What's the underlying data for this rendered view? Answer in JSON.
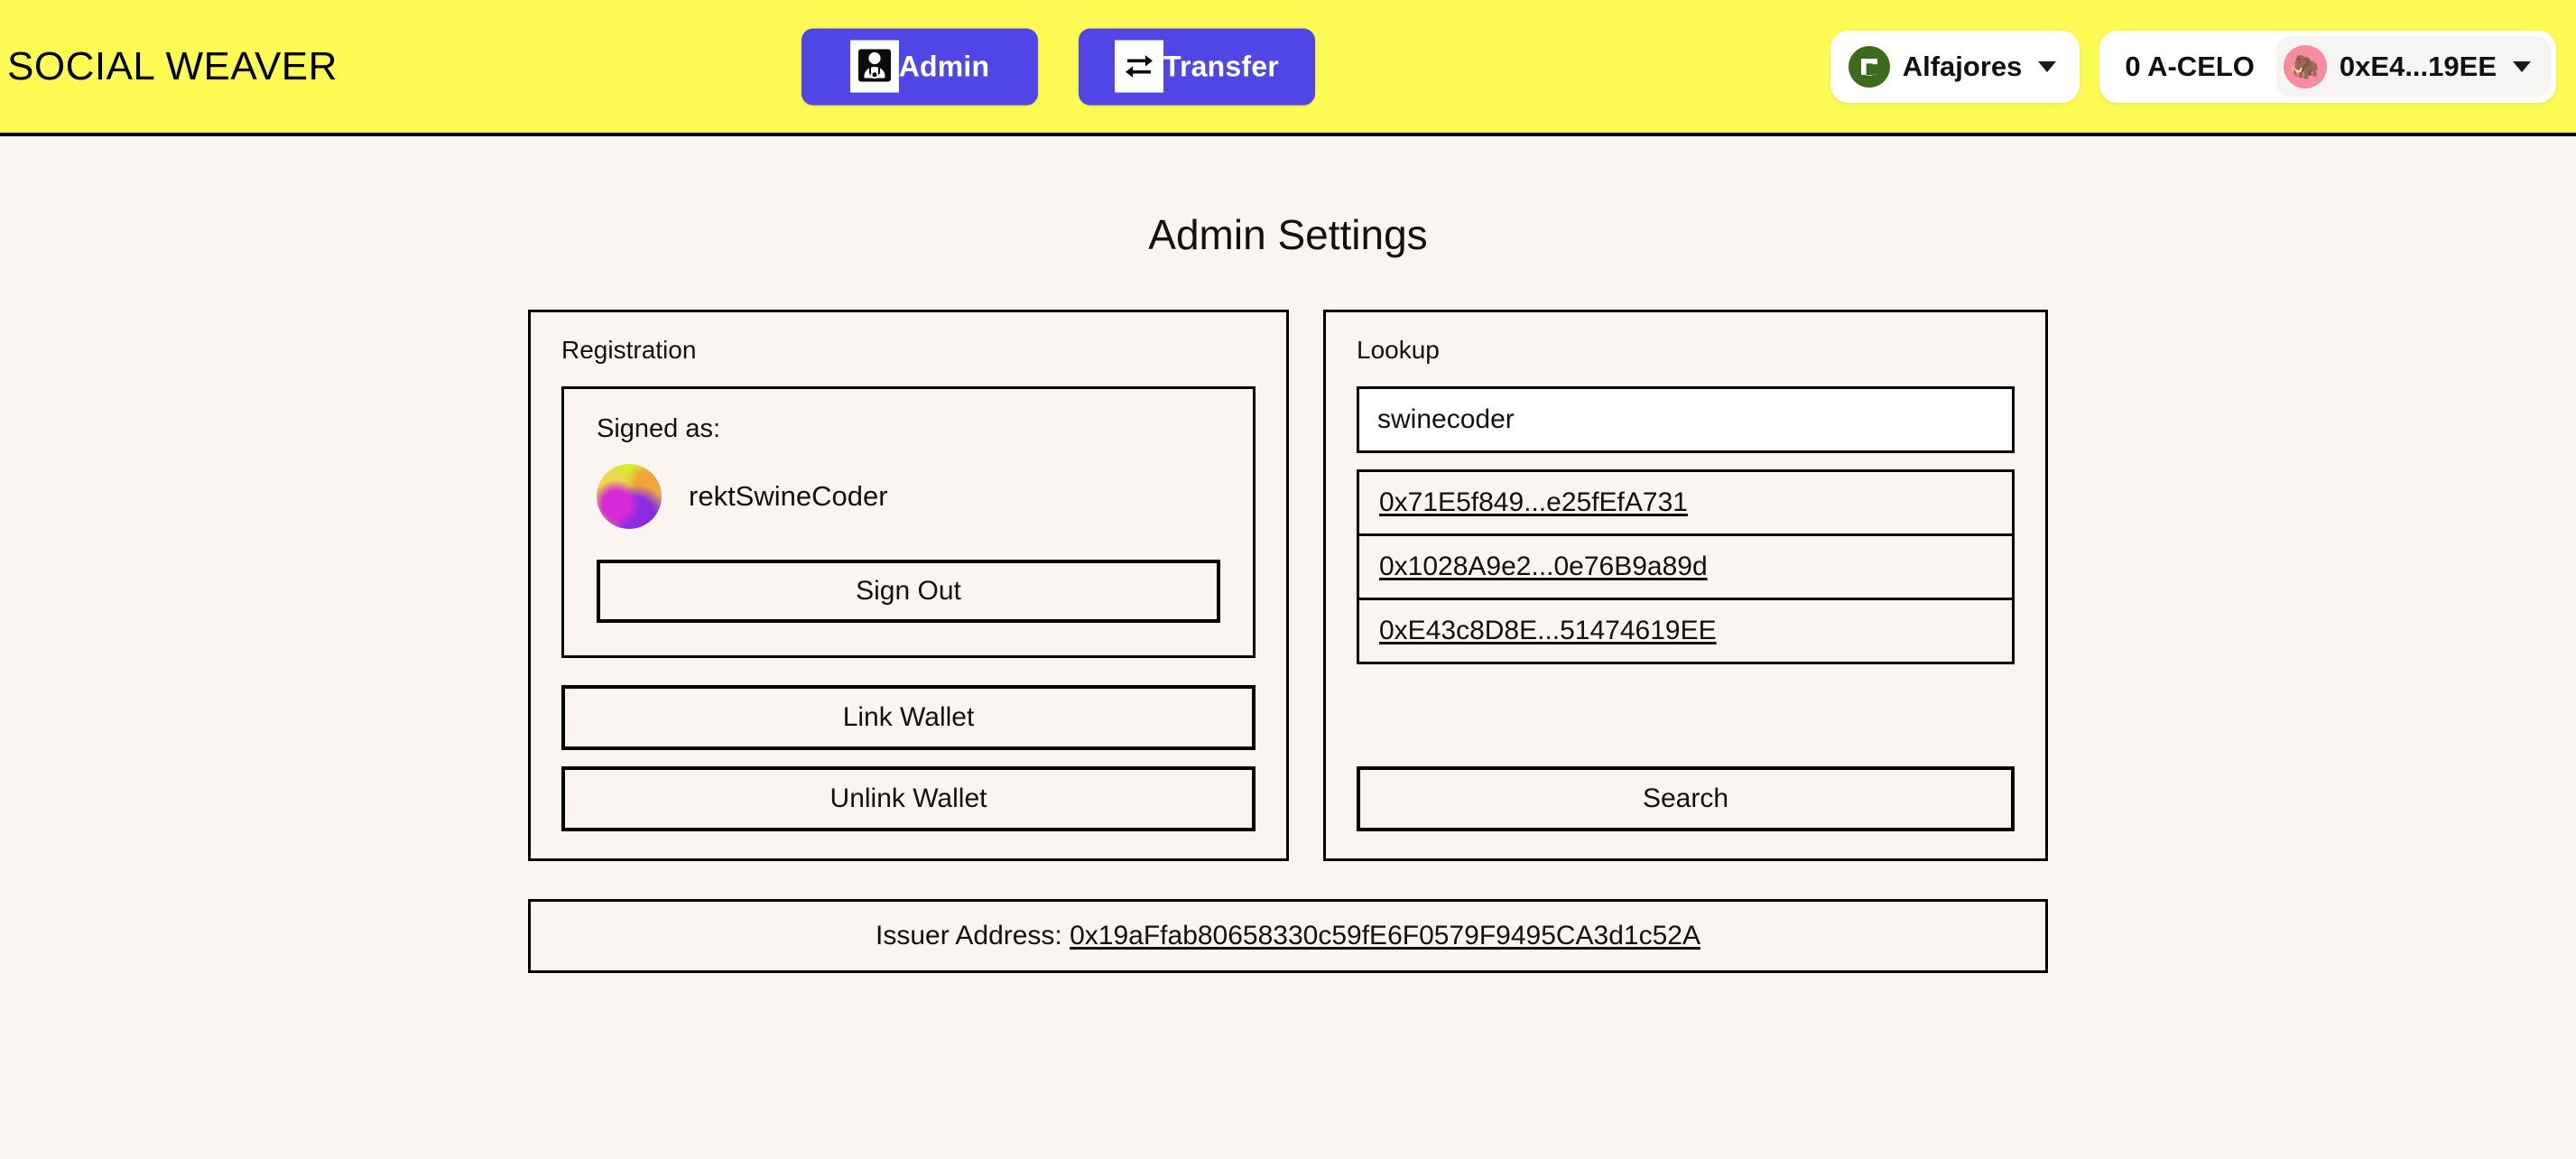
{
  "header": {
    "brand": "SOCIAL WEAVER",
    "nav": [
      {
        "label": "Admin",
        "icon": "person-stethoscope-icon"
      },
      {
        "label": "Transfer",
        "icon": "exchange-arrows-icon"
      }
    ],
    "wallet": {
      "chain_name": "Alfajores",
      "chain_icon": "celo-logo-icon",
      "balance": "0 A-CELO",
      "address": "0xE4...19EE",
      "avatar_icon": "flamingo-avatar-icon",
      "chevron_icon": "chevron-down-icon"
    },
    "colors": {
      "background": "#FDFB54",
      "nav_button": "#4F46E5",
      "celo_green": "#3D6B1E",
      "avatar_pink": "#F78CA0"
    }
  },
  "main": {
    "title": "Admin Settings",
    "background": "#FAF5F0",
    "registration": {
      "label": "Registration",
      "signed_as_label": "Signed as:",
      "username": "rektSwineCoder",
      "avatar_icon": "pig-avatar-icon",
      "sign_out_label": "Sign Out",
      "link_wallet_label": "Link Wallet",
      "unlink_wallet_label": "Unlink Wallet"
    },
    "lookup": {
      "label": "Lookup",
      "query_value": "swinecoder",
      "query_placeholder": "",
      "results": [
        {
          "address": "0x71E5f849...e25fEfA731"
        },
        {
          "address": "0x1028A9e2...0e76B9a89d"
        },
        {
          "address": "0xE43c8D8E...51474619EE"
        }
      ],
      "search_label": "Search"
    },
    "issuer": {
      "label": "Issuer Address:",
      "address": "0x19aFfab80658330c59fE6F0579F9495CA3d1c52A"
    }
  }
}
